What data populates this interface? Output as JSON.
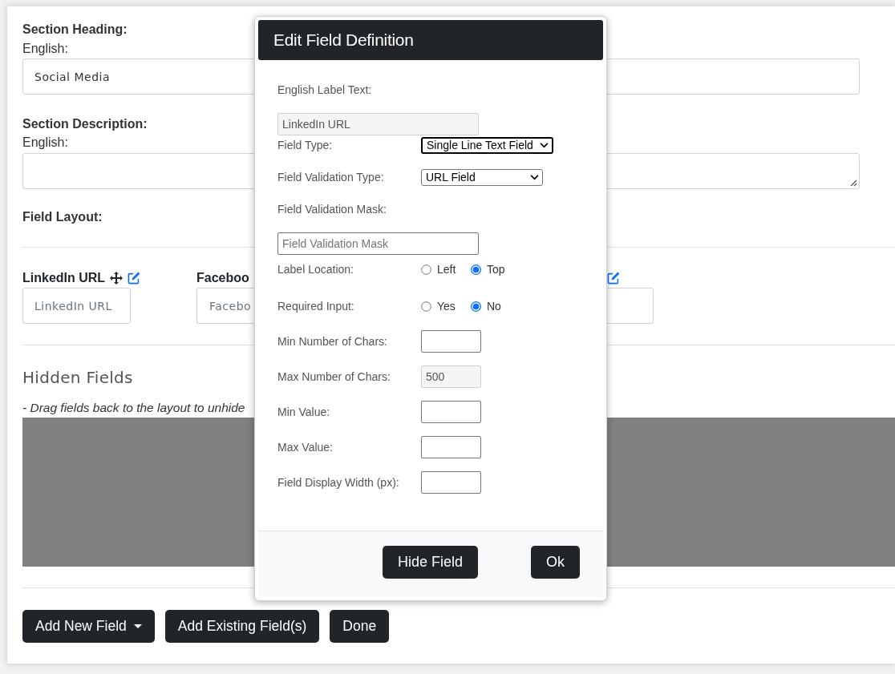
{
  "section_heading": {
    "label": "Section Heading:",
    "language": "English:",
    "value": "Social Media"
  },
  "section_description": {
    "label": "Section Description:",
    "language": "English:"
  },
  "field_layout": {
    "label": "Field Layout:",
    "fields": [
      {
        "kind": "full",
        "label": "LinkedIn URL",
        "placeholder": "LinkedIn URL"
      },
      {
        "kind": "covered_right",
        "label": "Faceboo",
        "placeholder": "Facebo"
      },
      {
        "kind": "covered_left"
      }
    ]
  },
  "hidden_fields": {
    "title": "Hidden Fields",
    "hint": "- Drag fields back to the layout to unhide"
  },
  "actions": [
    {
      "kind": "dropdown",
      "label": "Add New Field"
    },
    {
      "kind": "button",
      "label": "Add Existing Field(s)"
    },
    {
      "kind": "button",
      "label": "Done"
    }
  ],
  "modal": {
    "title": "Edit Field Definition",
    "rows": [
      {
        "kind": "stacked_text",
        "label": "English Label Text:",
        "value": "LinkedIn URL",
        "disabled": true
      },
      {
        "kind": "select",
        "label": "Field Type:",
        "value": "Single Line Text Field",
        "focused": true
      },
      {
        "kind": "select",
        "label": "Field Validation Type:",
        "value": "URL Field",
        "focused": false
      },
      {
        "kind": "stacked_text",
        "label": "Field Validation Mask:",
        "placeholder": "Field Validation Mask",
        "disabled": false
      },
      {
        "kind": "radio",
        "label": "Label Location:",
        "options": [
          {
            "label": "Left",
            "selected": false
          },
          {
            "label": "Top",
            "selected": true
          }
        ]
      },
      {
        "kind": "radio",
        "label": "Required Input:",
        "options": [
          {
            "label": "Yes",
            "selected": false
          },
          {
            "label": "No",
            "selected": true
          }
        ]
      },
      {
        "kind": "text",
        "label": "Min Number of Chars:",
        "disabled": false
      },
      {
        "kind": "text",
        "label": "Max Number of Chars:",
        "value": "500",
        "disabled": true
      },
      {
        "kind": "text",
        "label": "Min Value:",
        "disabled": false
      },
      {
        "kind": "text",
        "label": "Max Value:",
        "disabled": false
      },
      {
        "kind": "text",
        "label": "Field Display Width (px):",
        "disabled": false
      }
    ],
    "buttons": [
      {
        "label": "Hide Field"
      },
      {
        "label": "Ok"
      }
    ]
  }
}
